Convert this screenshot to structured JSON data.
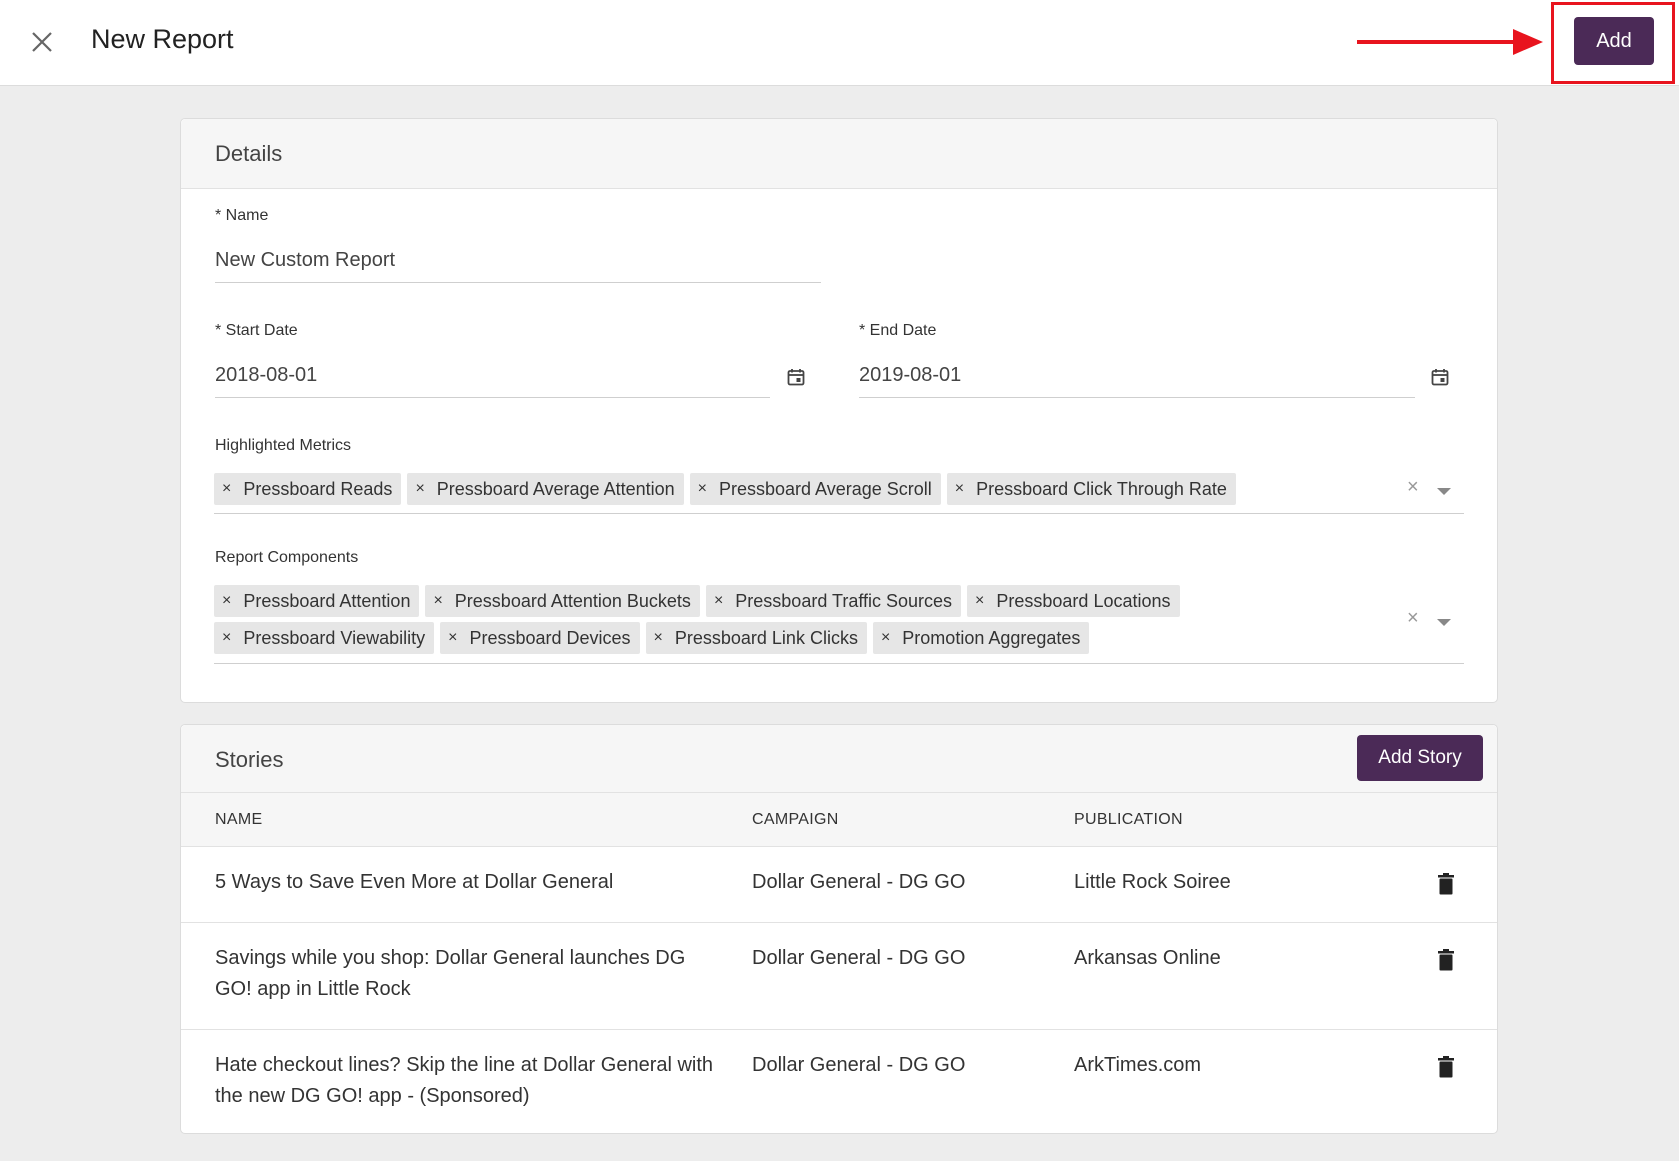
{
  "header": {
    "title": "New Report",
    "add_label": "Add"
  },
  "details": {
    "title": "Details",
    "name_label": "* Name",
    "name_value": "New Custom Report",
    "start_label": "* Start Date",
    "start_value": "2018-08-01",
    "end_label": "* End Date",
    "end_value": "2019-08-01",
    "metrics_label": "Highlighted Metrics",
    "metrics": [
      "Pressboard Reads",
      "Pressboard Average Attention",
      "Pressboard Average Scroll",
      "Pressboard Click Through Rate"
    ],
    "components_label": "Report Components",
    "components": [
      "Pressboard Attention",
      "Pressboard Attention Buckets",
      "Pressboard Traffic Sources",
      "Pressboard Locations",
      "Pressboard Viewability",
      "Pressboard Devices",
      "Pressboard Link Clicks",
      "Promotion Aggregates"
    ]
  },
  "stories": {
    "title": "Stories",
    "add_story_label": "Add Story",
    "columns": [
      "NAME",
      "CAMPAIGN",
      "PUBLICATION"
    ],
    "rows": [
      {
        "name": "5 Ways to Save Even More at Dollar General",
        "campaign": "Dollar General - DG GO",
        "publication": "Little Rock Soiree"
      },
      {
        "name": "Savings while you shop: Dollar General launches DG GO! app in Little Rock",
        "campaign": "Dollar General - DG GO",
        "publication": "Arkansas Online"
      },
      {
        "name": "Hate checkout lines? Skip the line at Dollar General with the new DG GO! app - (Sponsored)",
        "campaign": "Dollar General - DG GO",
        "publication": "ArkTimes.com"
      }
    ]
  },
  "colors": {
    "primary": "#4b2a57",
    "annotation": "#e8141e",
    "page_bg": "#ededed"
  },
  "icons": {
    "close": "close-icon",
    "calendar": "calendar-icon",
    "trash": "trash-icon",
    "dropdown": "chevron-down-icon",
    "clear": "clear-icon"
  }
}
